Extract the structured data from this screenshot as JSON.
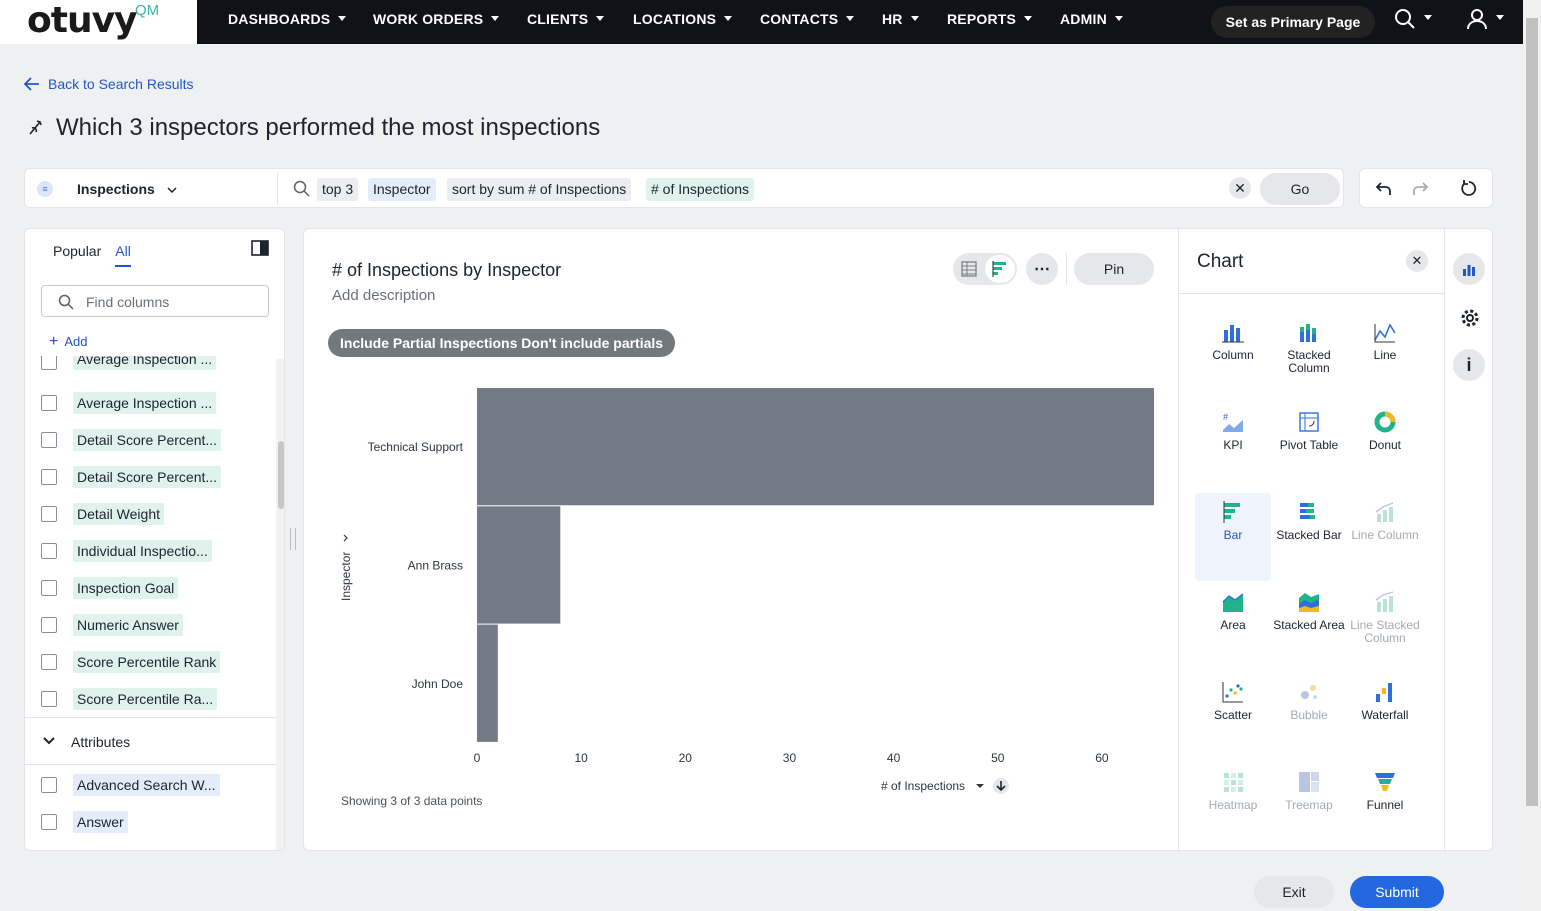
{
  "app": {
    "logo_text": "otuvy",
    "logo_suffix": "QM"
  },
  "nav": {
    "items": [
      "DASHBOARDS",
      "WORK ORDERS",
      "CLIENTS",
      "LOCATIONS",
      "CONTACTS",
      "HR",
      "REPORTS",
      "ADMIN"
    ],
    "primary_button": "Set as Primary Page"
  },
  "page": {
    "back_link": "Back to Search Results",
    "title": "Which 3 inspectors performed the most inspections"
  },
  "search": {
    "source": "Inspections",
    "tokens": [
      "top 3",
      "Inspector",
      "sort by sum # of Inspections",
      "# of Inspections"
    ],
    "go_label": "Go"
  },
  "left_panel": {
    "tabs": [
      "Popular",
      "All"
    ],
    "active_tab": "All",
    "find_placeholder": "Find columns",
    "add_label": "Add",
    "measures": [
      "Average Inspection ...",
      "Average Inspection ...",
      "Detail Score Percent...",
      "Detail Score Percent...",
      "Detail Weight",
      "Individual Inspectio...",
      "Inspection Goal",
      "Numeric Answer",
      "Score Percentile Rank",
      "Score Percentile Ra..."
    ],
    "attributes_heading": "Attributes",
    "attributes": [
      "Advanced Search W...",
      "Answer"
    ]
  },
  "chart_panel": {
    "title": "# of Inspections by Inspector",
    "description_placeholder": "Add description",
    "filter_label": "Include Partial Inspections",
    "filter_value": "Don't include partials",
    "pin_label": "Pin",
    "more_label": "⋯",
    "showing_text": "Showing 3 of 3 data points",
    "x_axis_label": "# of Inspections",
    "y_axis_label": "Inspector"
  },
  "chart_data": {
    "type": "bar",
    "orientation": "horizontal",
    "categories": [
      "Technical Support",
      "Ann Brass",
      "John Doe"
    ],
    "values": [
      65,
      8,
      2
    ],
    "xlabel": "# of Inspections",
    "ylabel": "Inspector",
    "xlim": [
      0,
      65
    ],
    "xticks": [
      0,
      10,
      20,
      30,
      40,
      50,
      60
    ],
    "bar_color": "#737c86",
    "grid": false
  },
  "chart_types": {
    "title": "Chart",
    "selected": "Bar",
    "items": [
      {
        "label": "Column",
        "disabled": false
      },
      {
        "label": "Stacked Column",
        "disabled": false
      },
      {
        "label": "Line",
        "disabled": false
      },
      {
        "label": "KPI",
        "disabled": false
      },
      {
        "label": "Pivot Table",
        "disabled": false
      },
      {
        "label": "Donut",
        "disabled": false
      },
      {
        "label": "Bar",
        "disabled": false
      },
      {
        "label": "Stacked Bar",
        "disabled": false
      },
      {
        "label": "Line Column",
        "disabled": true
      },
      {
        "label": "Area",
        "disabled": false
      },
      {
        "label": "Stacked Area",
        "disabled": false
      },
      {
        "label": "Line Stacked Column",
        "disabled": true
      },
      {
        "label": "Scatter",
        "disabled": false
      },
      {
        "label": "Bubble",
        "disabled": true
      },
      {
        "label": "Waterfall",
        "disabled": false
      },
      {
        "label": "Heatmap",
        "disabled": true
      },
      {
        "label": "Treemap",
        "disabled": true
      },
      {
        "label": "Funnel",
        "disabled": false
      }
    ]
  },
  "footer": {
    "exit_label": "Exit",
    "submit_label": "Submit"
  },
  "colors": {
    "accent": "#2357c9",
    "submit": "#2368e0",
    "nav_bg": "#101217",
    "bar": "#737c86"
  }
}
